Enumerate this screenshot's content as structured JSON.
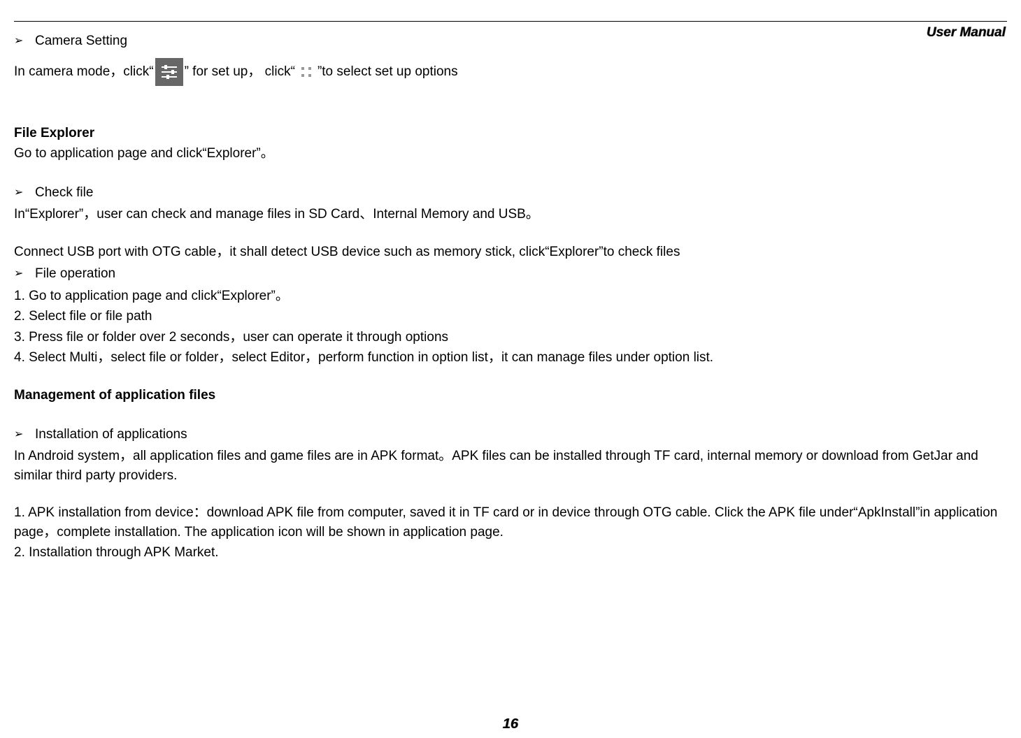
{
  "header": {
    "label": "User Manual"
  },
  "page_number": "16",
  "section_camera": {
    "bullet": "Camera Setting",
    "line_pre": "In camera mode，click“",
    "line_mid1": "” for set up， click“",
    "line_mid2": "”to select set up options"
  },
  "section_file_explorer": {
    "title": "File Explorer",
    "intro": "Go to application page and click“Explorer”。",
    "check_bullet": "Check file",
    "check_text": "In“Explorer”，user can check and manage files in SD Card、Internal Memory and USB。",
    "connect_text": "Connect USB port with OTG cable，it shall detect USB device such as memory stick, click“Explorer”to check files",
    "fileop_bullet": "File operation",
    "steps": [
      "1. Go to application page and click“Explorer”。",
      "2. Select file or file path",
      "3. Press file or folder over 2 seconds，user can operate it through options",
      "4. Select Multi，select file or folder，select Editor，perform function in option list，it can manage files under option list."
    ]
  },
  "section_mgmt": {
    "title": "Management of application files",
    "install_bullet": "Installation of applications",
    "install_text": "In Android system，all application files and game files are in APK format。APK files can be installed through TF card, internal memory or download from GetJar and similar third party providers.",
    "steps": [
      "1. APK installation from device：download APK file from computer, saved it in TF card or in device through OTG cable. Click the APK file under“ApkInstall”in application page，complete installation. The application icon will be shown in application page.",
      "2. Installation through APK Market."
    ]
  }
}
